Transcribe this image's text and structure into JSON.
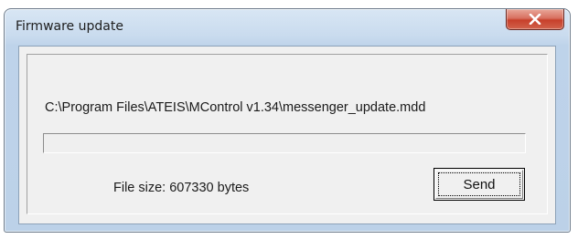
{
  "window": {
    "title": "Firmware update",
    "close_icon": "close-icon"
  },
  "content": {
    "file_path": "C:\\Program Files\\ATEIS\\MControl v1.34\\messenger_update.mdd",
    "progress_fraction": 0,
    "file_size_text": "File size: 607330 bytes",
    "send_label": "Send"
  },
  "colors": {
    "close_button": "#c7402b",
    "frame": "#bcd1e8",
    "dialog_bg": "#f0f0f0"
  }
}
